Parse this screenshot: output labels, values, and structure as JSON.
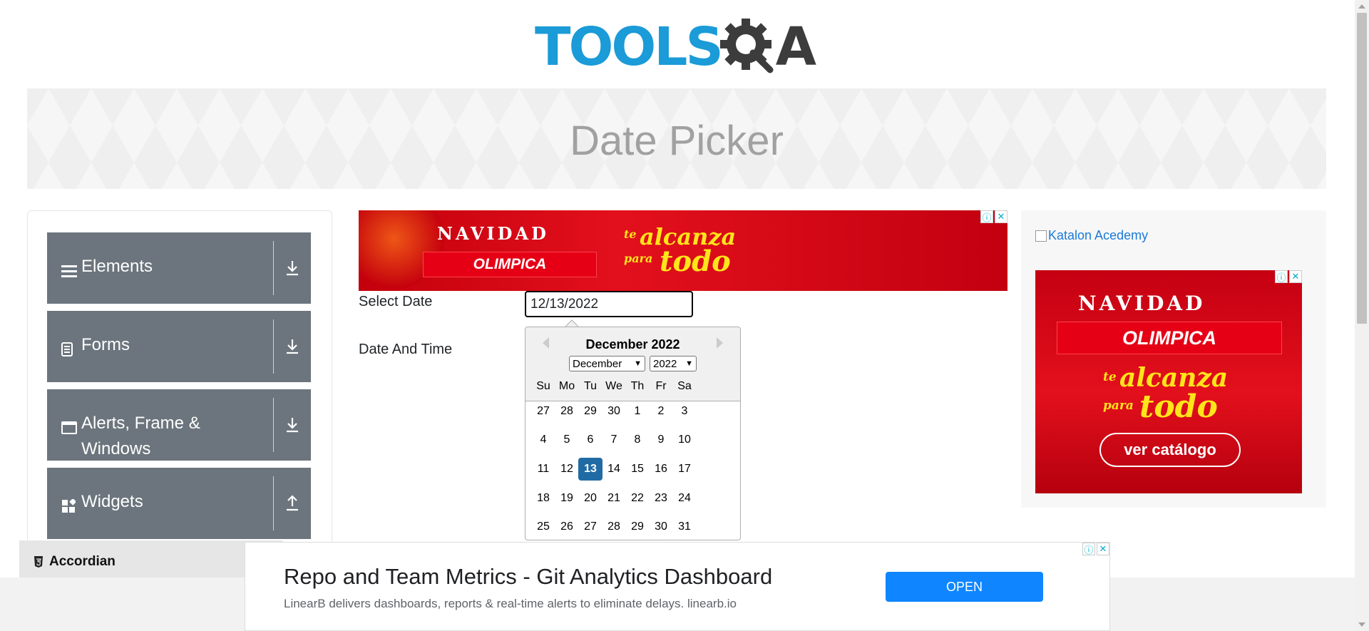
{
  "header": {
    "logo_tools": "TOOLS",
    "logo_qa": "A"
  },
  "banner": {
    "title": "Date Picker"
  },
  "sidebar": {
    "groups": [
      {
        "label": "Elements",
        "icon": "hamburger-icon",
        "arrow": "download-icon"
      },
      {
        "label": "Forms",
        "icon": "document-icon",
        "arrow": "download-icon"
      },
      {
        "label": "Alerts, Frame & Windows",
        "icon": "window-icon",
        "arrow": "download-icon"
      },
      {
        "label": "Widgets",
        "icon": "widgets-icon",
        "arrow": "upload-icon"
      }
    ],
    "sub_items": [
      {
        "label": "Accordian",
        "icon": "html5-icon"
      }
    ]
  },
  "ad_top": {
    "navidad": "NAVIDAD",
    "brand": "OLIMPICA",
    "te": "te",
    "alcanza": "alcanza",
    "para": "para",
    "todo": "todo"
  },
  "form": {
    "select_date_label": "Select Date",
    "select_date_value": "12/13/2022",
    "date_time_label": "Date And Time"
  },
  "calendar": {
    "title": "December 2022",
    "month_select": "December",
    "year_select": "2022",
    "weekdays": [
      "Su",
      "Mo",
      "Tu",
      "We",
      "Th",
      "Fr",
      "Sa"
    ],
    "weeks": [
      [
        "27",
        "28",
        "29",
        "30",
        "1",
        "2",
        "3"
      ],
      [
        "4",
        "5",
        "6",
        "7",
        "8",
        "9",
        "10"
      ],
      [
        "11",
        "12",
        "13",
        "14",
        "15",
        "16",
        "17"
      ],
      [
        "18",
        "19",
        "20",
        "21",
        "22",
        "23",
        "24"
      ],
      [
        "25",
        "26",
        "27",
        "28",
        "29",
        "30",
        "31"
      ]
    ],
    "selected_day": "13"
  },
  "right": {
    "katalon_link": "Katalon Acedemy",
    "ad_navidad": "NAVIDAD",
    "ad_brand": "OLIMPICA",
    "ad_te": "te",
    "ad_alcanza": "alcanza",
    "ad_para": "para",
    "ad_todo": "todo",
    "ad_button": "ver catálogo"
  },
  "ad_bottom": {
    "title": "Repo and Team Metrics - Git Analytics Dashboard",
    "subtitle": "LinearB delivers dashboards, reports & real-time alerts to eliminate delays. linearb.io",
    "button": "OPEN"
  },
  "colors": {
    "brand_blue": "#1b9bd7",
    "sidebar_group": "#6c757d",
    "selected_day": "#216ba5",
    "ad_red": "#e2101c",
    "ad_yellow": "#ffe51a",
    "open_button": "#0f86ff"
  }
}
